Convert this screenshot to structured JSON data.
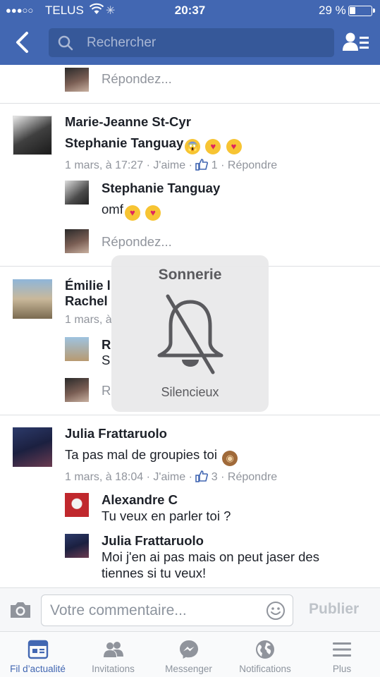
{
  "status": {
    "signal": "●●●○○",
    "carrier": "TELUS",
    "time": "20:37",
    "battery": "29 %",
    "battery_level": 0.29
  },
  "nav": {
    "search_placeholder": "Rechercher"
  },
  "feed": {
    "reply_placeholder": "Répondez...",
    "threads": [
      {
        "name": "Marie-Jeanne St-Cyr",
        "text": "Stephanie Tanguay",
        "emojis": [
          "scream",
          "heart-eyes",
          "heart-eyes"
        ],
        "timestamp": "1 mars, à 17:27",
        "like": "J'aime",
        "likes_count": "1",
        "reply": "Répondre",
        "replies": [
          {
            "name": "Stephanie Tanguay",
            "text": "omf",
            "emojis": [
              "heart-eyes",
              "heart-eyes"
            ]
          }
        ]
      },
      {
        "name": "Émilie l",
        "text": "Rachel",
        "timestamp": "1 mars, à",
        "replies": [
          {
            "name": "R",
            "text": "S"
          }
        ],
        "reply_placeholder_visible": "R"
      },
      {
        "name": "Julia Frattaruolo",
        "text": "Ta pas mal de groupies toi",
        "emojis": [
          "see-no-evil-monkey"
        ],
        "timestamp": "1 mars, à 18:04",
        "like": "J'aime",
        "likes_count": "3",
        "reply": "Répondre",
        "replies": [
          {
            "name": "Alexandre C",
            "text": "Tu veux en parler toi ?"
          },
          {
            "name": "Julia Frattaruolo",
            "text_line1": "Moi j'en ai pas mais on peut jaser des",
            "text_line2": "tiennes si tu veux!"
          }
        ]
      }
    ]
  },
  "hud": {
    "title": "Sonnerie",
    "subtitle": "Silencieux"
  },
  "composer": {
    "placeholder": "Votre commentaire...",
    "post_label": "Publier"
  },
  "tabs": [
    {
      "label": "Fil d’actualité",
      "icon": "news-feed-icon",
      "active": true
    },
    {
      "label": "Invitations",
      "icon": "friend-requests-icon"
    },
    {
      "label": "Messenger",
      "icon": "messenger-icon"
    },
    {
      "label": "Notifications",
      "icon": "globe-icon"
    },
    {
      "label": "Plus",
      "icon": "menu-icon"
    }
  ],
  "colors": {
    "brand": "#4267b2",
    "search_bg": "#365899",
    "meta_text": "#90949c"
  }
}
